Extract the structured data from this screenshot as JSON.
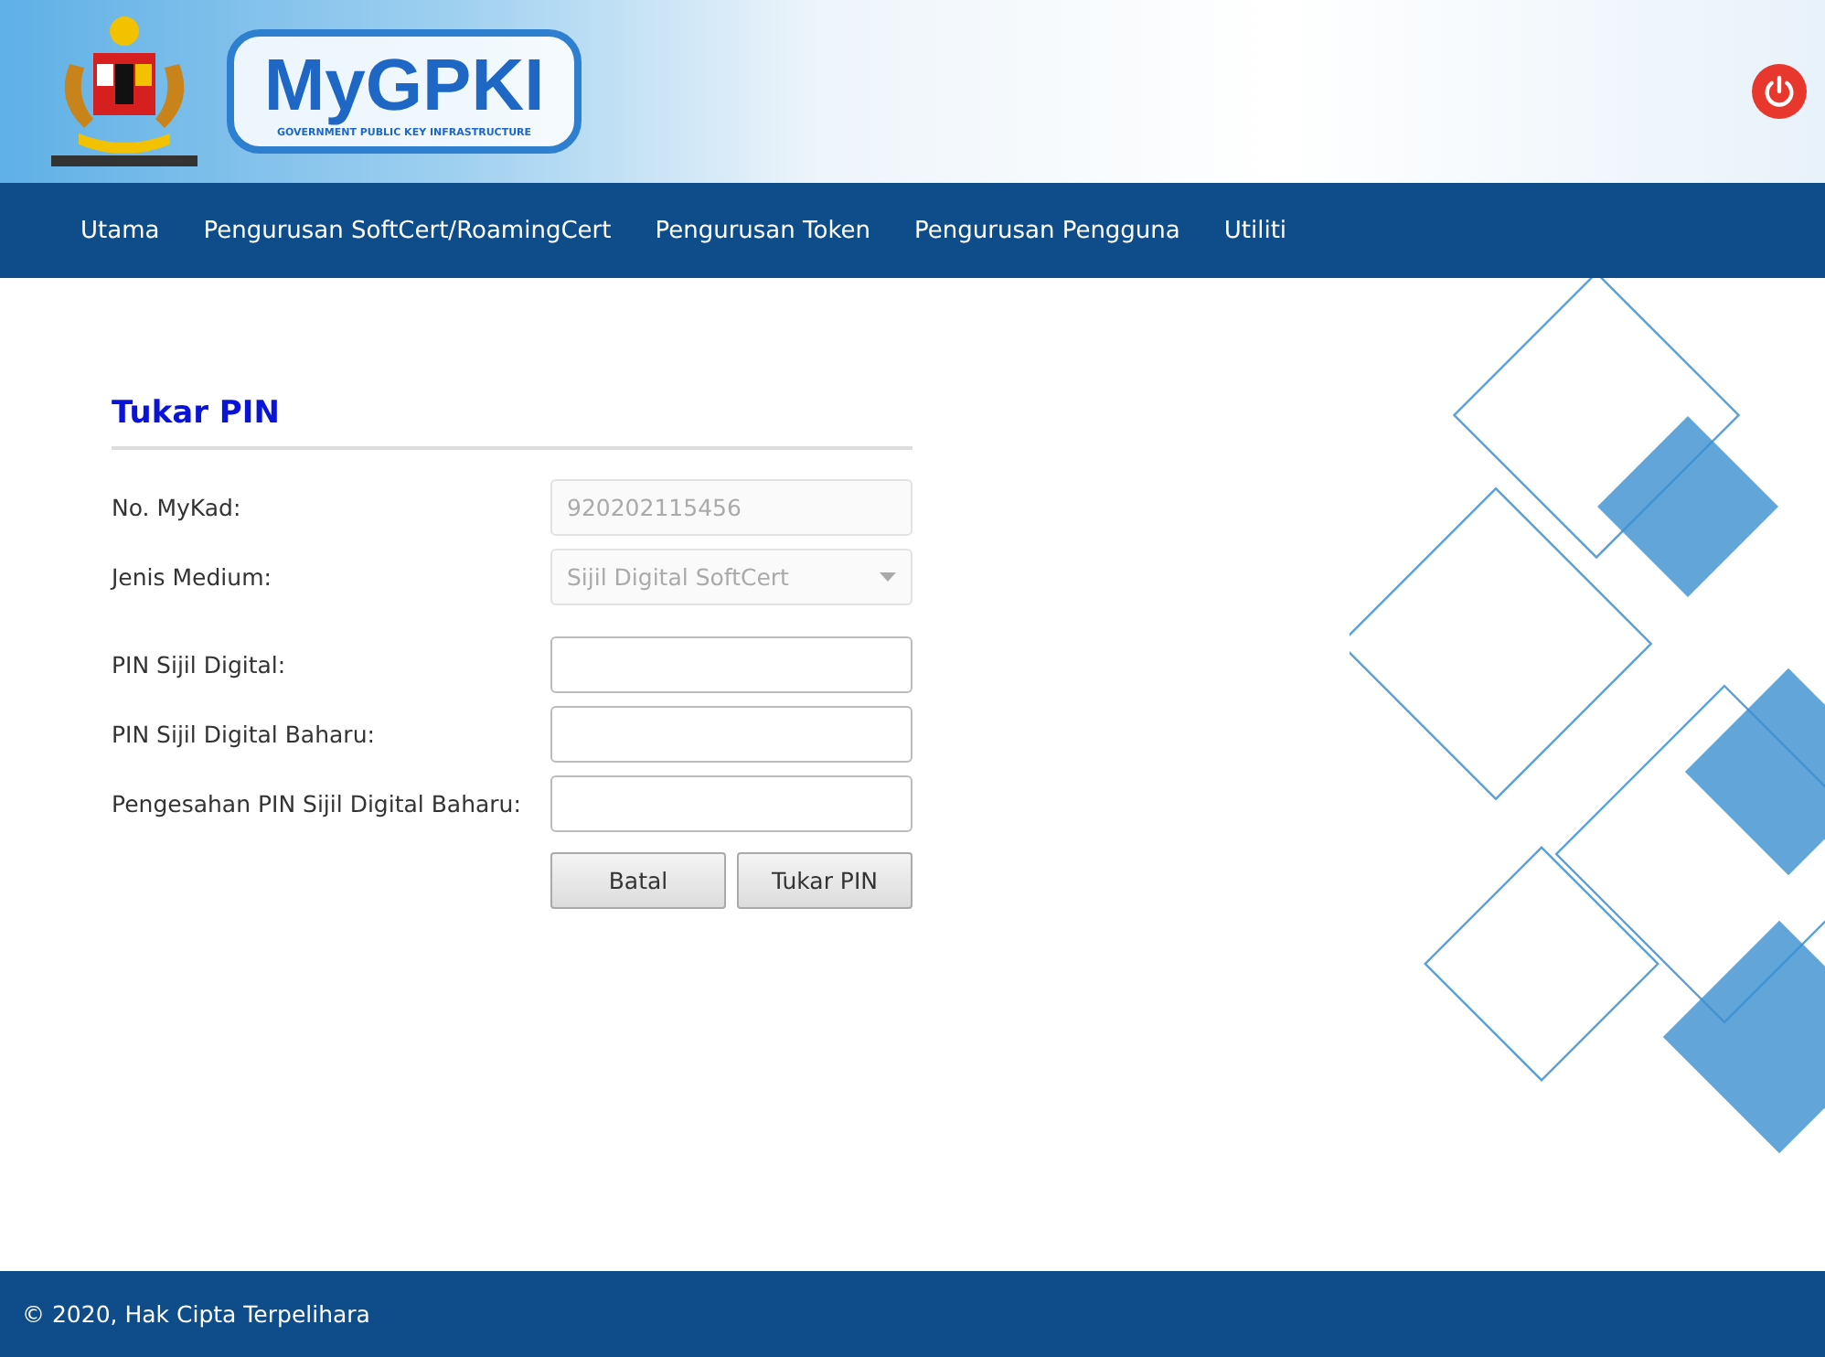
{
  "header": {
    "logo_title": "MyGPKI",
    "logo_subtitle": "GOVERNMENT PUBLIC KEY INFRASTRUCTURE"
  },
  "nav": [
    {
      "label": "Utama"
    },
    {
      "label": "Pengurusan SoftCert/RoamingCert"
    },
    {
      "label": "Pengurusan Token"
    },
    {
      "label": "Pengurusan Pengguna"
    },
    {
      "label": "Utiliti"
    }
  ],
  "form": {
    "title": "Tukar PIN",
    "fields": [
      {
        "kind": "text",
        "label": "No. MyKad:",
        "value": "920202115456",
        "disabled": true
      },
      {
        "kind": "select",
        "label": "Jenis Medium:",
        "value": "Sijil Digital SoftCert",
        "disabled": true
      },
      {
        "kind": "password",
        "label": "PIN Sijil Digital:",
        "disabled": false
      },
      {
        "kind": "password",
        "label": "PIN Sijil Digital Baharu:",
        "disabled": false
      },
      {
        "kind": "password",
        "label": "Pengesahan PIN Sijil Digital Baharu:",
        "disabled": false
      }
    ],
    "buttons": [
      "Batal",
      "Tukar PIN"
    ]
  },
  "footer": {
    "text": "© 2020, Hak Cipta Terpelihara"
  }
}
